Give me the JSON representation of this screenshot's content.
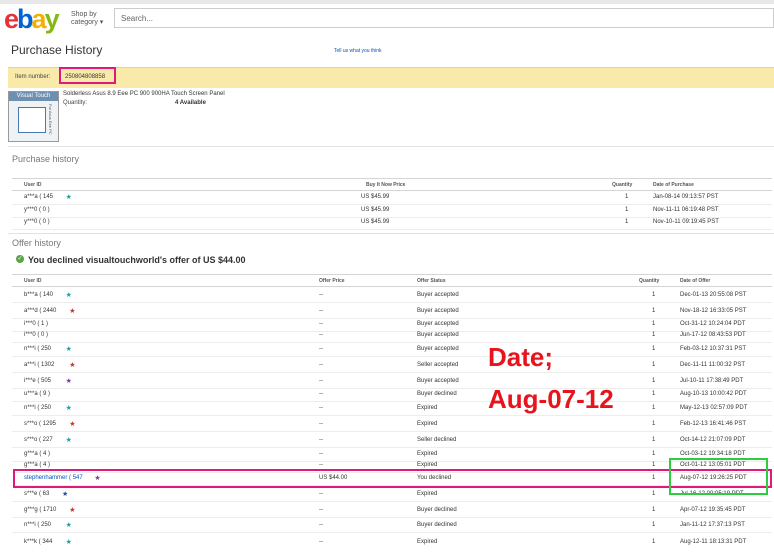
{
  "header": {
    "logo": [
      "e",
      "b",
      "a",
      "y"
    ],
    "shop_by": [
      "Shop by",
      "category ▾"
    ],
    "search_placeholder": "Search..."
  },
  "page": {
    "title": "Purchase History",
    "tell_us": "Tell us what you think",
    "item_label": "Item number:",
    "item_number": "250804808858",
    "thumb_header": "Visual Touch",
    "thumb_side": "For Asus Eee PC",
    "item_title": "Solderless Asus 8.9 Eee PC 900 900HA Touch Screen Panel",
    "quantity_label": "Quantity:",
    "quantity_value": "4 Available"
  },
  "purchase_history": {
    "heading": "Purchase history",
    "columns": [
      "User ID",
      "Buy It Now Price",
      "Quantity",
      "Date of Purchase"
    ],
    "rows": [
      {
        "user": "a***a ( 145",
        "star_color": "#1aa3a3",
        "price": "US $45.99",
        "qty": "1",
        "date": "Jan-08-14 09:13:57 PST"
      },
      {
        "user": "y***0 ( 0 )",
        "star_color": "",
        "price": "US $45.99",
        "qty": "1",
        "date": "Nov-11-11 06:19:48 PST"
      },
      {
        "user": "y***0 ( 0 )",
        "star_color": "",
        "price": "US $45.99",
        "qty": "1",
        "date": "Nov-10-11 09:19:45 PST"
      }
    ]
  },
  "offer_history": {
    "heading": "Offer history",
    "declined_message": "You declined visualtouchworld's offer of US $44.00",
    "columns": [
      "User ID",
      "Offer Price",
      "Offer Status",
      "Quantity",
      "Date of Offer"
    ],
    "rows": [
      {
        "user": "b***a ( 140",
        "star_color": "#1aa3a3",
        "price": "--",
        "status": "Buyer accepted",
        "qty": "1",
        "date": "Dec-01-13 20:55:08 PST"
      },
      {
        "user": "a***d ( 2440",
        "star_color": "#c0392b",
        "price": "--",
        "status": "Buyer accepted",
        "qty": "1",
        "date": "Nov-18-12 16:33:05 PST"
      },
      {
        "user": "i***0 ( 1 )",
        "star_color": "",
        "price": "--",
        "status": "Buyer accepted",
        "qty": "1",
        "date": "Oct-31-12 10:24:04 PDT"
      },
      {
        "user": "i***0 ( 0 )",
        "star_color": "",
        "price": "--",
        "status": "Buyer accepted",
        "qty": "1",
        "date": "Jun-17-12 08:43:53 PDT"
      },
      {
        "user": "n***i ( 250",
        "star_color": "#1aa3a3",
        "price": "--",
        "status": "Buyer accepted",
        "qty": "1",
        "date": "Feb-03-12 10:37:31 PST"
      },
      {
        "user": "a***i ( 1302",
        "star_color": "#c0392b",
        "price": "--",
        "status": "Seller accepted",
        "qty": "1",
        "date": "Dec-11-11 11:00:32 PST"
      },
      {
        "user": "i***e ( 505",
        "star_color": "#7d3c98",
        "price": "--",
        "status": "Buyer accepted",
        "qty": "1",
        "date": "Jul-10-11 17:38:49 PDT"
      },
      {
        "user": "u***a ( 9 )",
        "star_color": "",
        "price": "--",
        "status": "Buyer declined",
        "qty": "1",
        "date": "Aug-10-13 10:00:42 PDT"
      },
      {
        "user": "n***i ( 250",
        "star_color": "#1aa3a3",
        "price": "--",
        "status": "Expired",
        "qty": "1",
        "date": "May-12-13 02:57:09 PDT"
      },
      {
        "user": "s***o ( 1295",
        "star_color": "#c0392b",
        "price": "--",
        "status": "Expired",
        "qty": "1",
        "date": "Feb-12-13 16:41:46 PST"
      },
      {
        "user": "s***o ( 227",
        "star_color": "#1aa3a3",
        "price": "--",
        "status": "Seller declined",
        "qty": "1",
        "date": "Oct-14-12 21:07:09 PDT"
      },
      {
        "user": "g***a ( 4 )",
        "star_color": "",
        "price": "--",
        "status": "Expired",
        "qty": "1",
        "date": "Oct-03-12 19:34:18 PDT"
      },
      {
        "user": "g***a ( 4 )",
        "star_color": "",
        "price": "--",
        "status": "Expired",
        "qty": "1",
        "date": "Oct-01-12 13:05:01 PDT"
      },
      {
        "user": "stephenhammer ( 547",
        "star_color": "#7d3c98",
        "price": "US $44.00",
        "status": "You declined",
        "qty": "1",
        "date": "Aug-07-12 19:26:25 PDT"
      },
      {
        "user": "s***e ( 63",
        "star_color": "#1f4fb0",
        "price": "--",
        "status": "Expired",
        "qty": "1",
        "date": "Jul-16-12 00:05:19 PDT"
      },
      {
        "user": "g***g ( 1710",
        "star_color": "#c0392b",
        "price": "--",
        "status": "Buyer declined",
        "qty": "1",
        "date": "Apr-07-12 19:35:45 PDT"
      },
      {
        "user": "n***i ( 250",
        "star_color": "#1aa3a3",
        "price": "--",
        "status": "Buyer declined",
        "qty": "1",
        "date": "Jan-11-12 17:37:13 PST"
      },
      {
        "user": "k***k ( 344",
        "star_color": "#1aa3a3",
        "price": "--",
        "status": "Expired",
        "qty": "1",
        "date": "Aug-12-11 18:13:31 PDT"
      }
    ]
  },
  "annotation": {
    "line1": "Date;",
    "line2": "Aug-07-12",
    "highlight_color": "#e0197d",
    "green_color": "#2ecc40"
  }
}
